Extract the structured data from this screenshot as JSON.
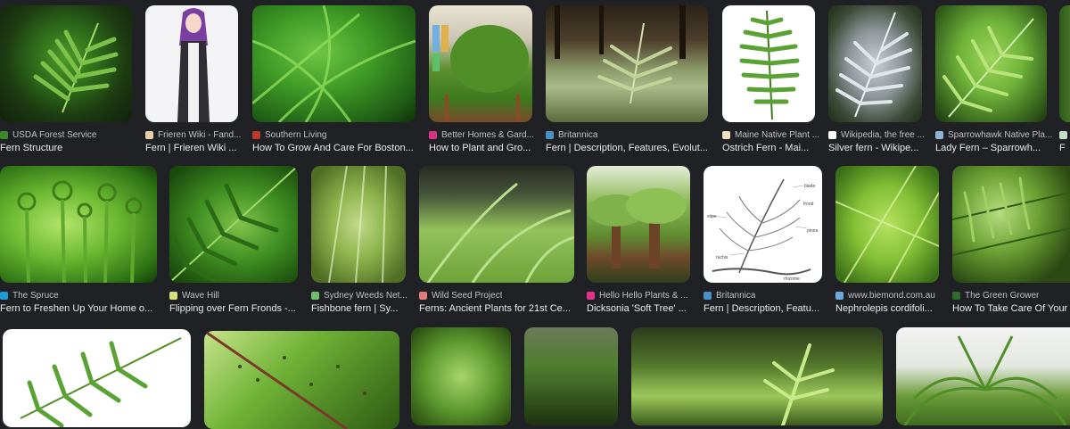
{
  "colors": {
    "background": "#202124",
    "source_text": "#bdc1c6",
    "title_text": "#e8eaed"
  },
  "row1": [
    {
      "source": "USDA Forest Service",
      "title": "Fern Structure",
      "favicon": "#3a8a2b",
      "icon": "usda-favicon-icon"
    },
    {
      "source": "Frieren Wiki - Fand...",
      "title": "Fern | Frieren Wiki ...",
      "favicon": "#e8d0a8",
      "icon": "fandom-favicon-icon"
    },
    {
      "source": "Southern Living",
      "title": "How To Grow And Care For Boston...",
      "favicon": "#c0392b",
      "icon": "southern-living-favicon-icon"
    },
    {
      "source": "Better Homes & Gard...",
      "title": "How to Plant and Gro...",
      "favicon": "#d63384",
      "icon": "bhg-favicon-icon"
    },
    {
      "source": "Britannica",
      "title": "Fern | Description, Features, Evolut...",
      "favicon": "#4a90c2",
      "icon": "britannica-favicon-icon"
    },
    {
      "source": "Maine Native Plant ...",
      "title": "Ostrich Fern - Mai...",
      "favicon": "#f0e0c0",
      "icon": "maine-favicon-icon"
    },
    {
      "source": "Wikipedia, the free ...",
      "title": "Silver fern - Wikipe...",
      "favicon": "#ffffff",
      "icon": "wikipedia-favicon-icon"
    },
    {
      "source": "Sparrowhawk Native Pla...",
      "title": "Lady Fern – Sparrowh...",
      "favicon": "#8fb4d8",
      "icon": "sparrowhawk-favicon-icon"
    },
    {
      "source": "F",
      "title": "F",
      "favicon": "#c3e0c8",
      "icon": "partial-favicon-icon"
    }
  ],
  "row2": [
    {
      "source": "The Spruce",
      "title": "Fern to Freshen Up Your Home o...",
      "favicon": "#1f9bd8",
      "icon": "the-spruce-favicon-icon"
    },
    {
      "source": "Wave Hill",
      "title": "Flipping over Fern Fronds -...",
      "favicon": "#d8e07a",
      "icon": "wave-hill-favicon-icon"
    },
    {
      "source": "Sydney Weeds Net...",
      "title": "Fishbone fern | Sy...",
      "favicon": "#6fbf6a",
      "icon": "sydney-weeds-favicon-icon"
    },
    {
      "source": "Wild Seed Project",
      "title": "Ferns: Ancient Plants for 21st Ce...",
      "favicon": "#e07a7a",
      "icon": "wild-seed-favicon-icon"
    },
    {
      "source": "Hello Hello Plants & ...",
      "title": "Dicksonia 'Soft Tree' ...",
      "favicon": "#e0328a",
      "icon": "hello-hello-favicon-icon"
    },
    {
      "source": "Britannica",
      "title": "Fern | Description, Featu...",
      "favicon": "#4a90c2",
      "icon": "britannica-favicon-icon"
    },
    {
      "source": "www.biemond.com.au",
      "title": "Nephrolepis cordifoli...",
      "favicon": "#6fa8d8",
      "icon": "biemond-favicon-icon"
    },
    {
      "source": "The Green Grower",
      "title": "How To Take Care Of Your F",
      "favicon": "#2f6b2a",
      "icon": "green-grower-favicon-icon"
    }
  ],
  "diagram_labels": [
    "blade",
    "stipe",
    "rachis",
    "pinna",
    "frond",
    "rhizome"
  ]
}
